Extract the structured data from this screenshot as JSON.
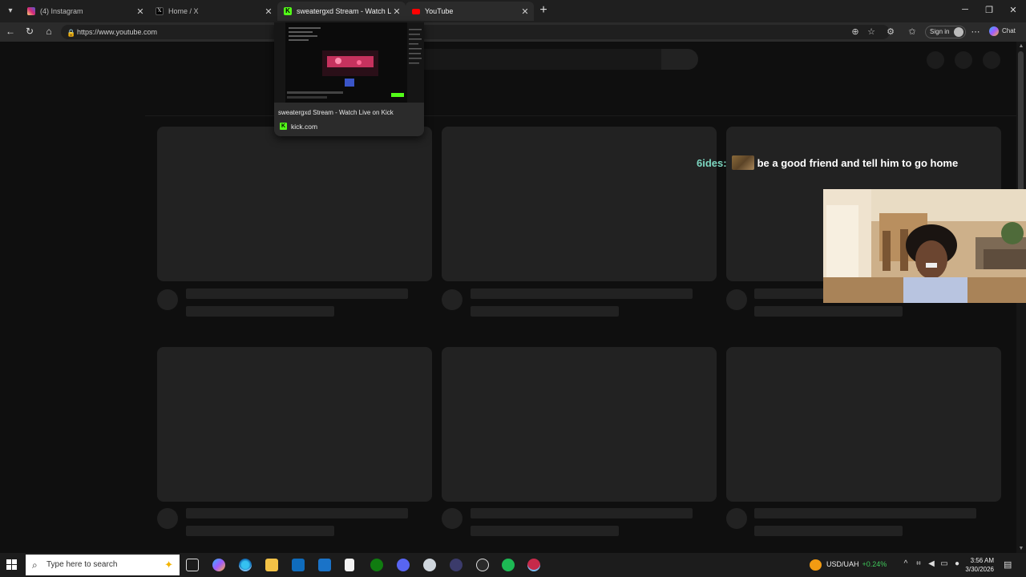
{
  "browser": {
    "tabs": [
      {
        "title": "(4) Instagram",
        "color": "#d6249f",
        "active": false
      },
      {
        "title": "Home / X",
        "color": "#000000",
        "active": false
      },
      {
        "title": "sweatergxd Stream - Watch Live on Kick",
        "color": "#53fc18",
        "active": false
      },
      {
        "title": "YouTube",
        "color": "#ff0000",
        "active": true
      }
    ],
    "url": "https://www.youtube.com",
    "sign_in_label": "Sign in",
    "copilot_label": "Chat"
  },
  "tab_preview": {
    "title": "sweatergxd Stream - Watch Live on Kick",
    "domain": "kick.com"
  },
  "stream_overlay": {
    "chat_user": "6ides:",
    "chat_message": "be a good friend and tell him to go home"
  },
  "taskbar": {
    "search_placeholder": "Type here to search",
    "ticker_label": "USD/UAH",
    "ticker_change": "+0.24%",
    "time": "3:56 AM",
    "date": "3/30/2026"
  },
  "colors": {
    "accent": "#53fc18",
    "youtube_red": "#ff0000",
    "positive": "#3fc85a"
  }
}
